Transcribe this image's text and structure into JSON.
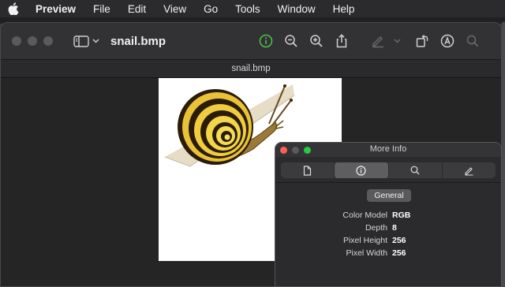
{
  "menubar": {
    "items": [
      {
        "label": "Preview"
      },
      {
        "label": "File"
      },
      {
        "label": "Edit"
      },
      {
        "label": "View"
      },
      {
        "label": "Go"
      },
      {
        "label": "Tools"
      },
      {
        "label": "Window"
      },
      {
        "label": "Help"
      }
    ]
  },
  "window": {
    "title": "snail.bmp",
    "tab_title": "snail.bmp",
    "toolbar_icons": [
      "info-icon",
      "zoom-out-icon",
      "zoom-in-icon",
      "share-icon",
      "markup-icon",
      "chevron-down-icon",
      "rotate-icon",
      "annotate-icon",
      "search-icon"
    ]
  },
  "info_panel": {
    "title": "More Info",
    "tabs": [
      "document-icon",
      "info-icon",
      "search-icon",
      "pencil-icon"
    ],
    "active_section": "General",
    "rows": [
      {
        "key": "Color Model",
        "value": "RGB"
      },
      {
        "key": "Depth",
        "value": "8"
      },
      {
        "key": "Pixel Height",
        "value": "256"
      },
      {
        "key": "Pixel Width",
        "value": "256"
      }
    ]
  },
  "colors": {
    "accent_green": "#4cc24c",
    "close_red": "#ff5f57",
    "minimize_yellow": "#5a5a5c",
    "zoom_green": "#28c840"
  }
}
